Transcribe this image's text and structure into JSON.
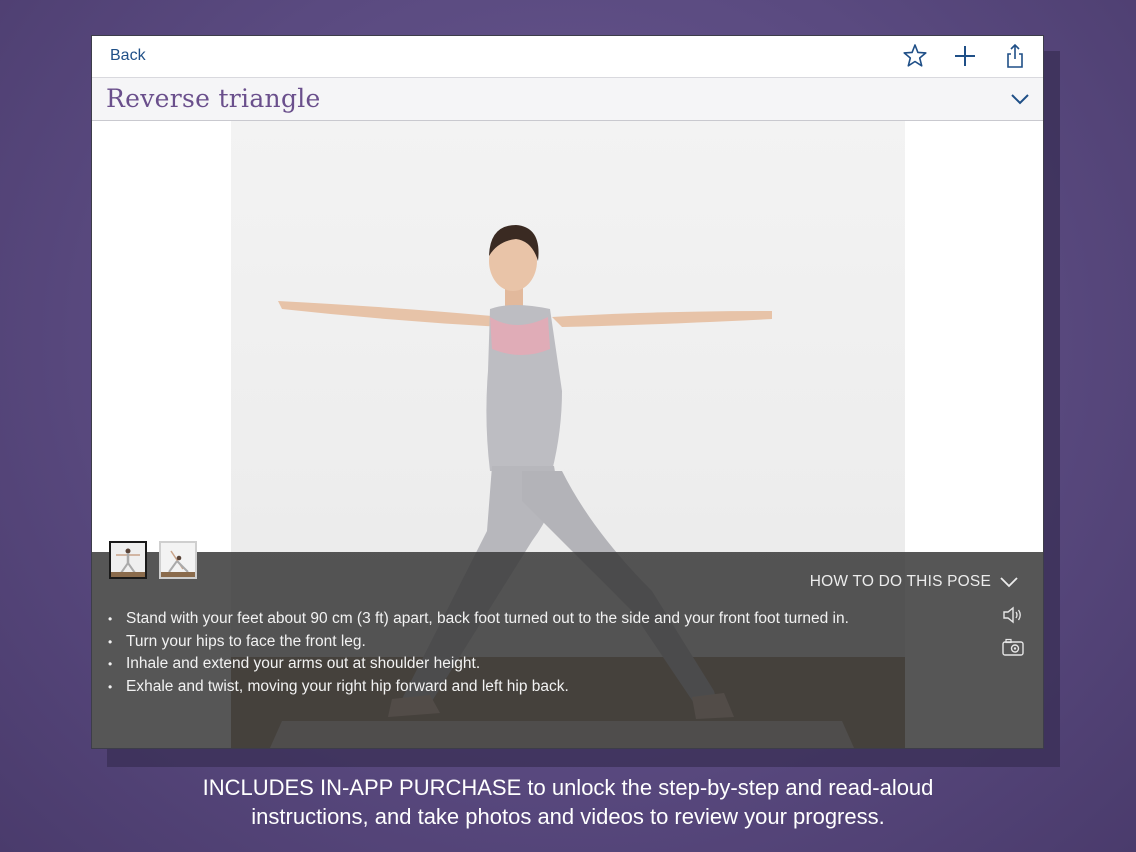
{
  "nav": {
    "back_label": "Back",
    "icons": [
      "star-icon",
      "plus-icon",
      "share-icon"
    ]
  },
  "pose": {
    "title": "Reverse triangle"
  },
  "thumbnails": [
    {
      "name": "thumbnail-standing-pose",
      "selected": true
    },
    {
      "name": "thumbnail-twisted-pose",
      "selected": false
    }
  ],
  "instructions": {
    "header": "HOW TO DO THIS POSE",
    "steps": [
      "Stand with your feet about 90 cm (3 ft) apart, back foot turned out to the side and your front foot turned in.",
      "Turn your hips to face the front leg.",
      "Inhale and extend your arms out at shoulder height.",
      "Exhale and twist, moving your right hip forward and left hip back."
    ],
    "side_icons": [
      "speaker-icon",
      "camera-icon"
    ]
  },
  "caption": {
    "line1": "INCLUDES IN-APP PURCHASE to unlock the step-by-step and read-aloud",
    "line2": "instructions, and take photos and videos to review your progress."
  },
  "colors": {
    "background": "#5a4a80",
    "title": "#6a4f8c",
    "link": "#1f4f87",
    "overlay": "#3a3a3a"
  }
}
